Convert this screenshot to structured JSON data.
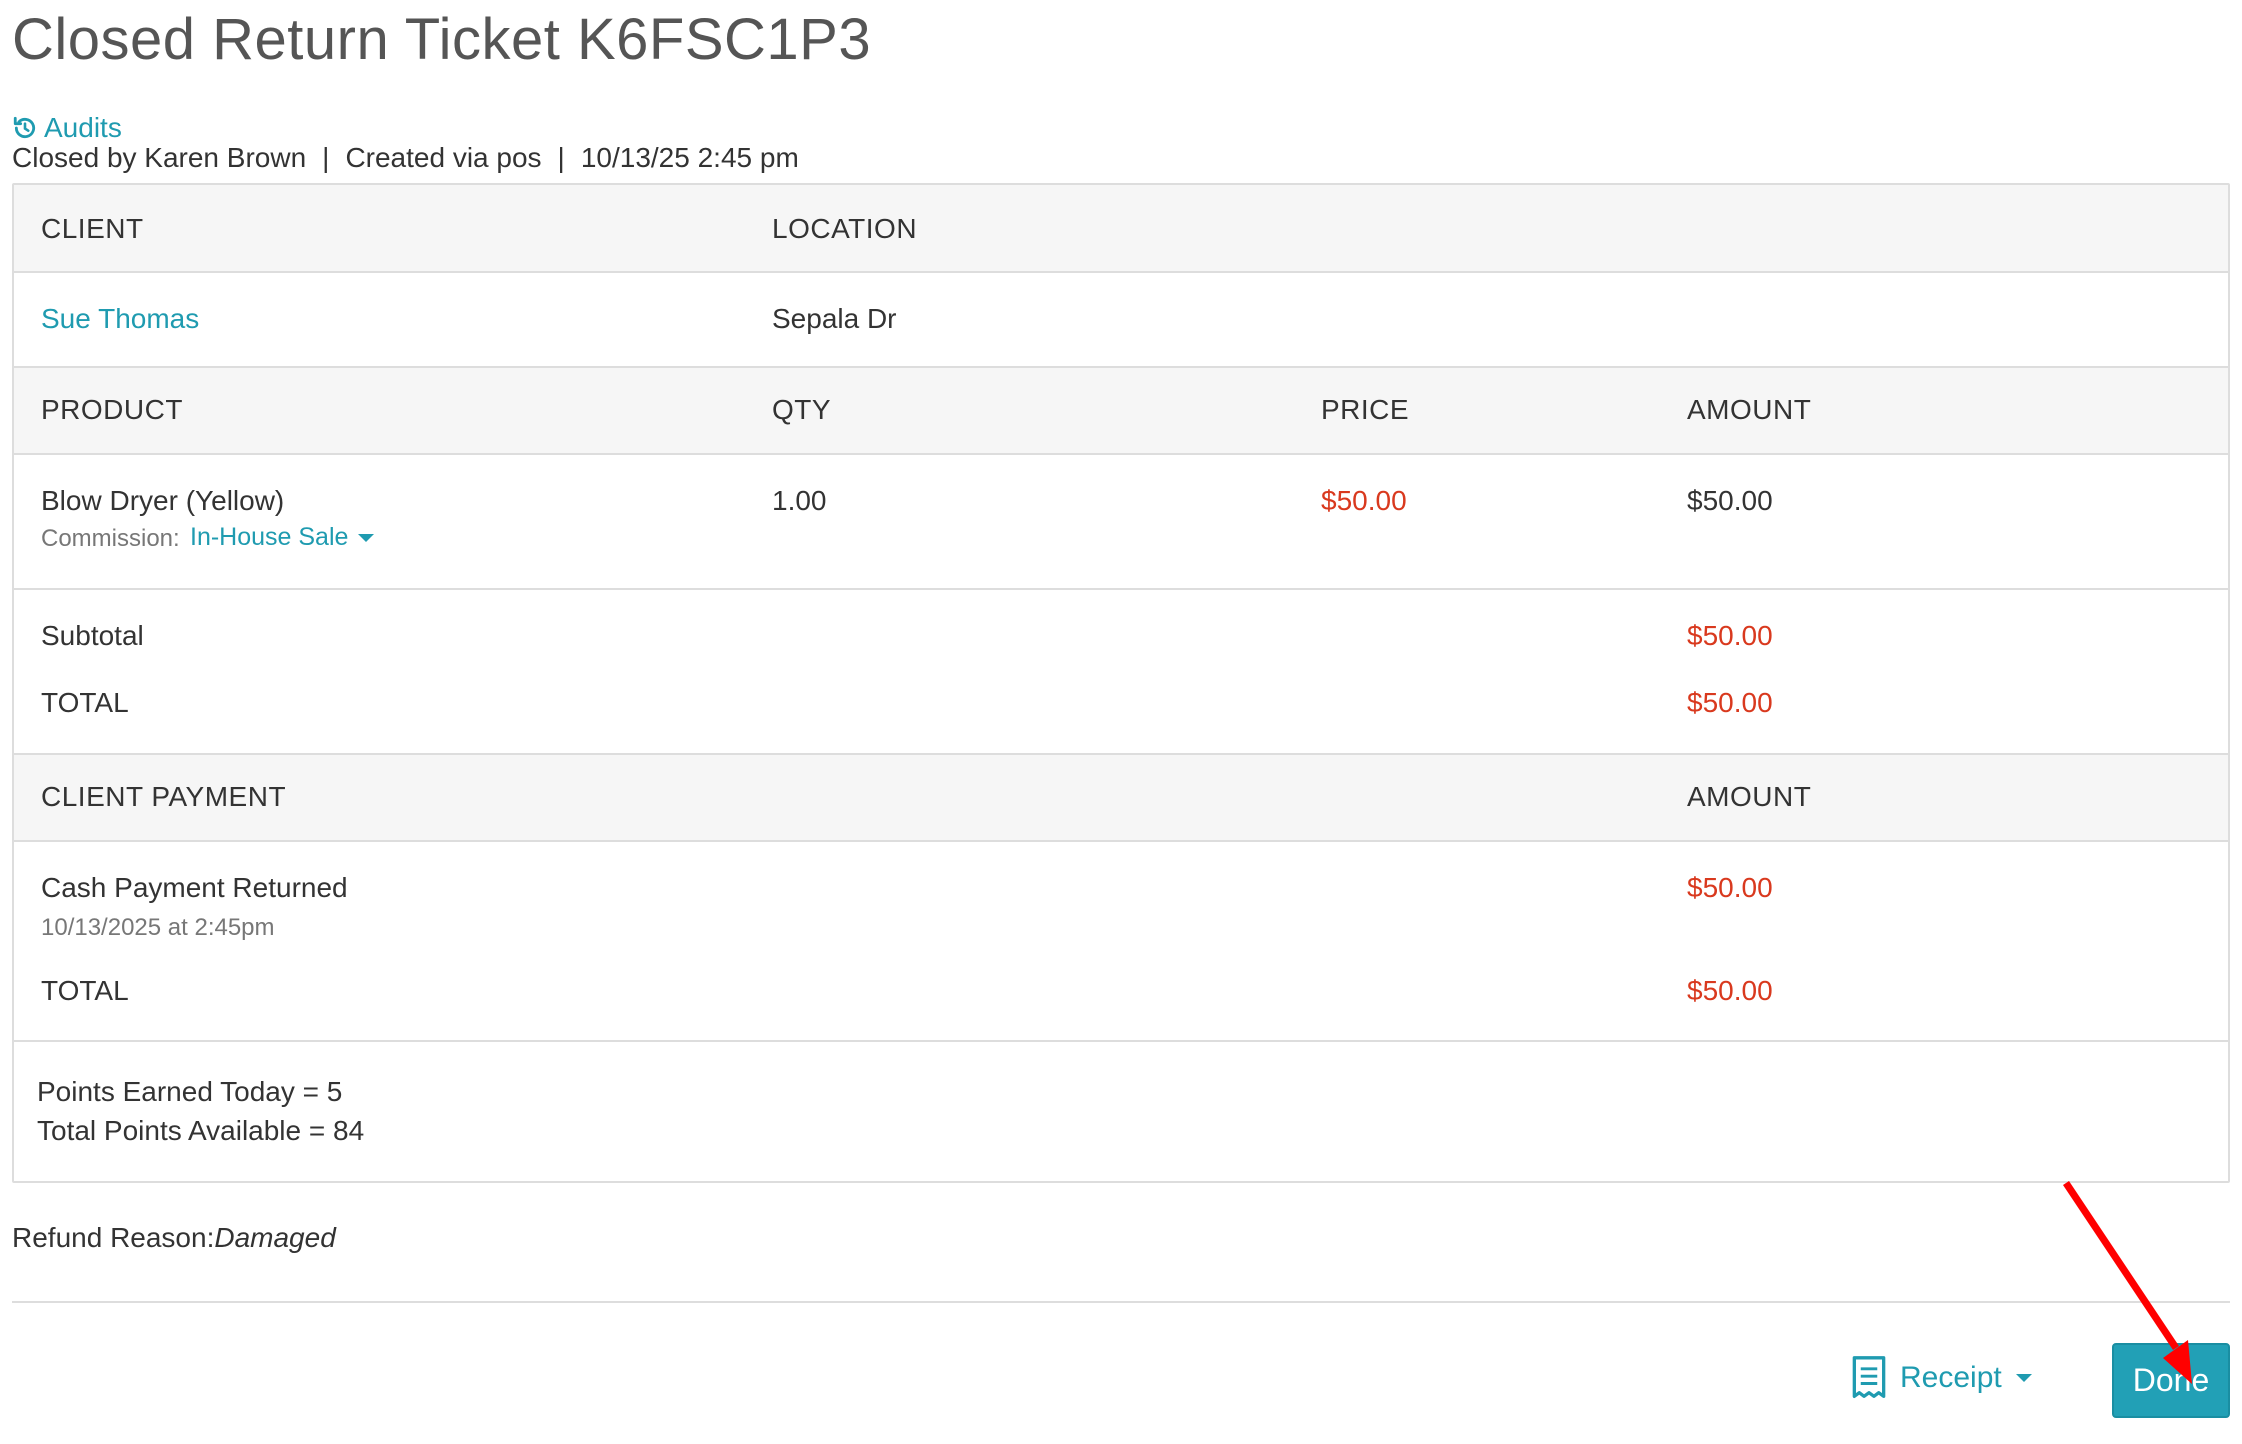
{
  "page": {
    "title": "Closed Return Ticket K6FSC1P3",
    "audits_label": "Audits",
    "meta": {
      "closed_by": "Closed by Karen Brown",
      "created_via": "Created via pos",
      "datetime": "10/13/25 2:45 pm",
      "separator": "|"
    }
  },
  "client_section": {
    "headers": {
      "client": "CLIENT",
      "location": "LOCATION"
    },
    "client_name": "Sue Thomas",
    "location": "Sepala Dr"
  },
  "products": {
    "headers": {
      "product": "PRODUCT",
      "qty": "QTY",
      "price": "PRICE",
      "amount": "AMOUNT"
    },
    "items": [
      {
        "name": "Blow Dryer (Yellow)",
        "commission_label": "Commission:",
        "commission_value": "In-House Sale",
        "qty": "1.00",
        "price": "$50.00",
        "amount": "$50.00"
      }
    ]
  },
  "totals": {
    "subtotal_label": "Subtotal",
    "subtotal_value": "$50.00",
    "total_label": "TOTAL",
    "total_value": "$50.00"
  },
  "payments": {
    "headers": {
      "client_payment": "CLIENT PAYMENT",
      "amount": "AMOUNT"
    },
    "items": [
      {
        "name": "Cash Payment Returned",
        "timestamp": "10/13/2025 at 2:45pm",
        "amount": "$50.00"
      }
    ],
    "total_label": "TOTAL",
    "total_value": "$50.00"
  },
  "points": {
    "earned_today": "Points Earned Today = 5",
    "total_available": "Total Points Available = 84"
  },
  "refund": {
    "label": "Refund Reason:",
    "value": "Damaged"
  },
  "actions": {
    "receipt_label": "Receipt",
    "done_label": "Done"
  },
  "colors": {
    "accent": "#1f9bb0",
    "button": "#22a0b6",
    "amount_red": "#d9391e",
    "header_bg": "#f6f6f6",
    "border": "#dddddd",
    "annotation_arrow": "#ff0000"
  }
}
